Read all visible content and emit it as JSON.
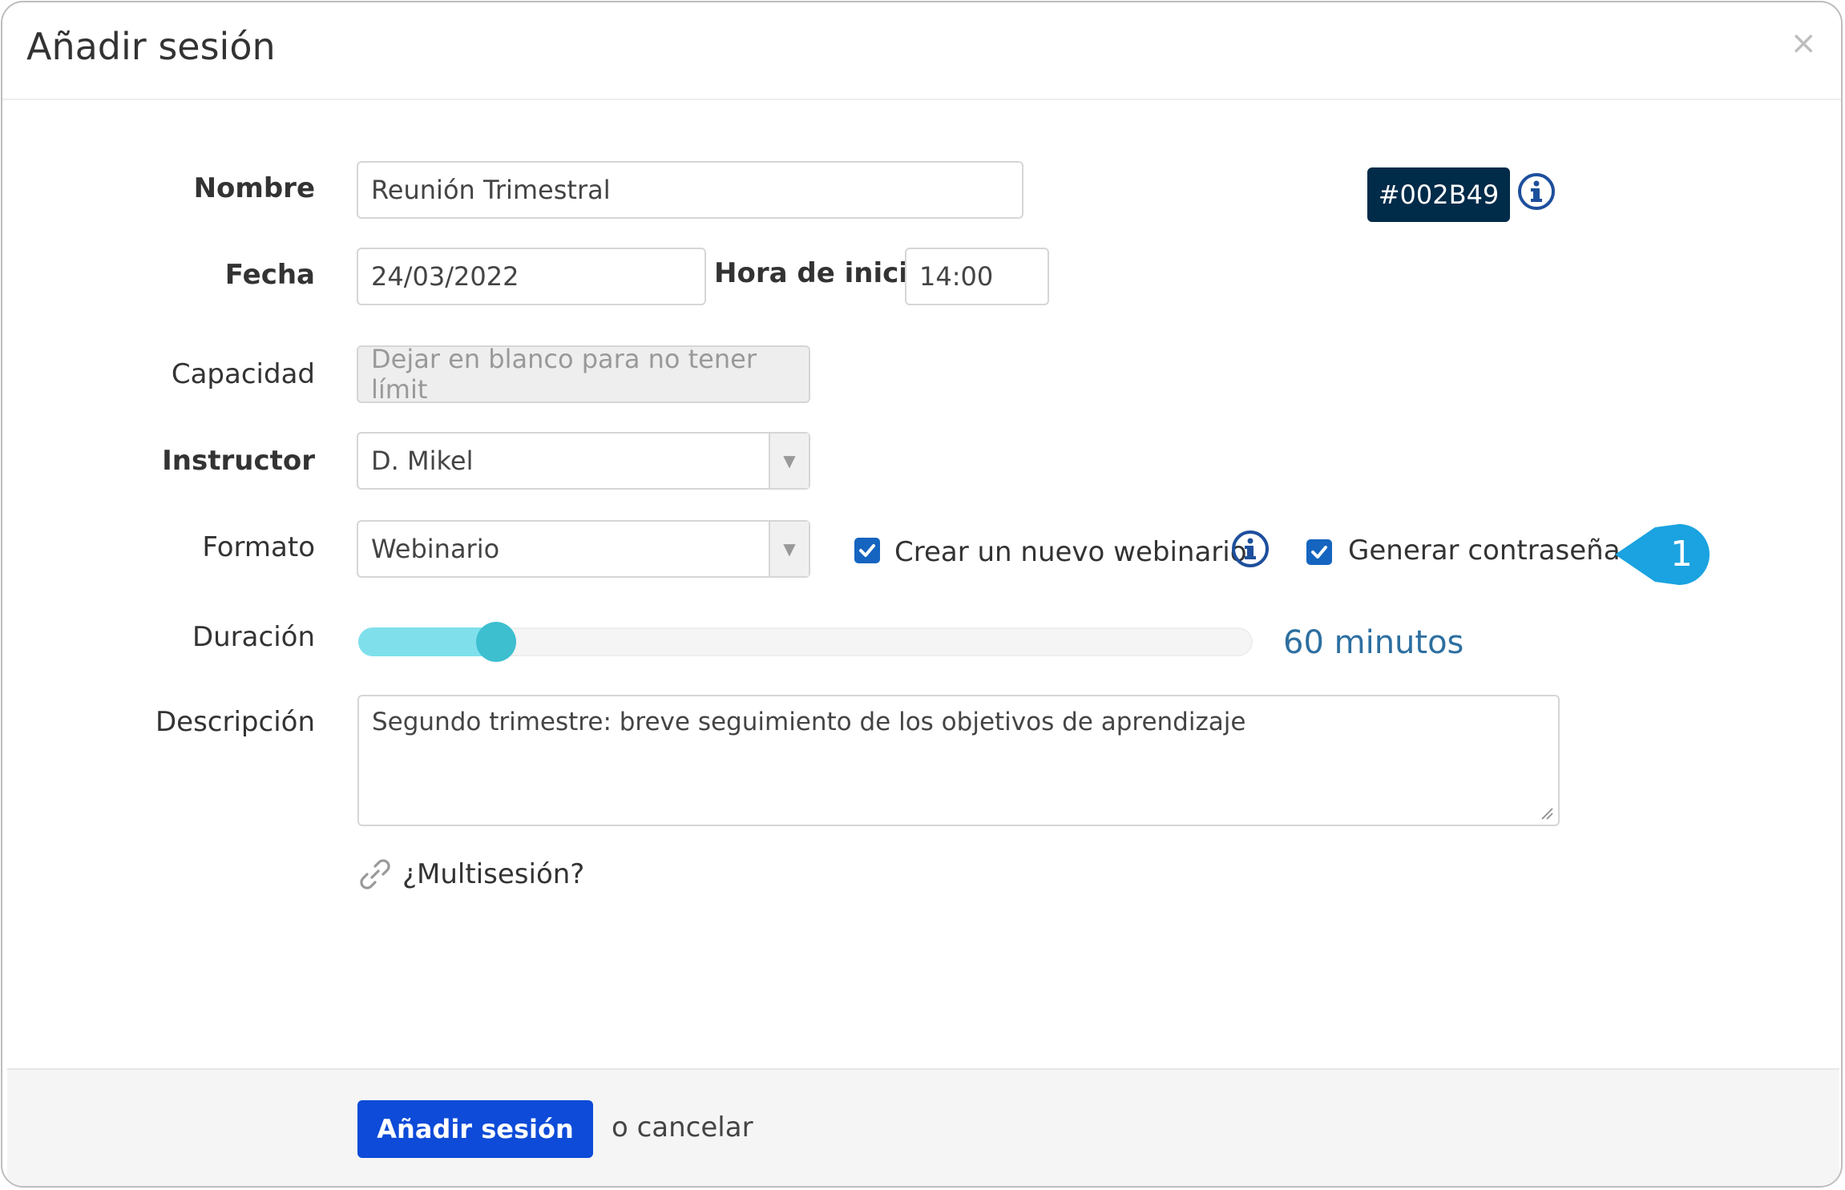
{
  "dialog": {
    "title": "Añadir sesión",
    "close_label": "×"
  },
  "form": {
    "name": {
      "label": "Nombre",
      "value": "Reunión Trimestral"
    },
    "color": {
      "value": "#002B49"
    },
    "date": {
      "label": "Fecha",
      "value": "24/03/2022"
    },
    "start_time": {
      "label": "Hora de inicio",
      "value": "14:00"
    },
    "capacity": {
      "label": "Capacidad",
      "placeholder": "Dejar en blanco para no tener límit"
    },
    "instructor": {
      "label": "Instructor",
      "selected": "D. Mikel"
    },
    "format": {
      "label": "Formato",
      "selected": "Webinario"
    },
    "create_webinar": {
      "label": "Crear un nuevo webinario",
      "checked": true
    },
    "generate_password": {
      "label": "Generar contraseña",
      "checked": true
    },
    "duration": {
      "label": "Duración",
      "value_text": "60 minutos",
      "level": 0.1
    },
    "description": {
      "label": "Descripción",
      "value": "Segundo trimestre: breve seguimiento de los objetivos de aprendizaje"
    },
    "multisession": {
      "label": "¿Multisesión?"
    }
  },
  "annotation": {
    "number": "1",
    "color": "#1aa3e0"
  },
  "footer": {
    "submit_label": "Añadir sesión",
    "cancel_label": "o cancelar"
  },
  "colors": {
    "primary_button": "#0d4bd8",
    "chip": "#002B49",
    "info_icon": "#1d4f9c",
    "slider": "#3dbfcf"
  }
}
